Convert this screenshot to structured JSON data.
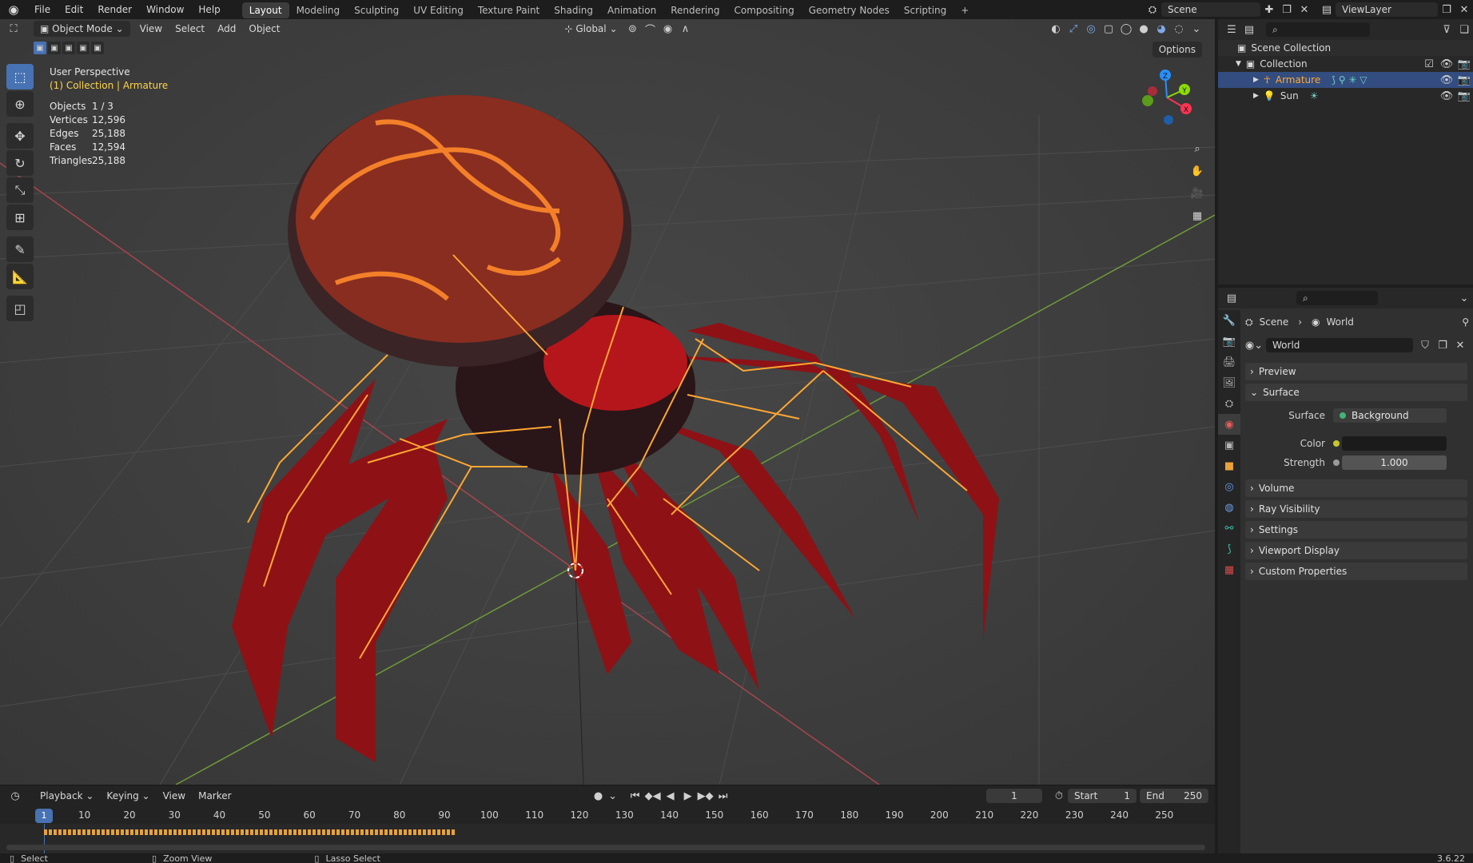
{
  "topbar": {
    "menu": [
      "File",
      "Edit",
      "Render",
      "Window",
      "Help"
    ],
    "workspaces": [
      "Layout",
      "Modeling",
      "Sculpting",
      "UV Editing",
      "Texture Paint",
      "Shading",
      "Animation",
      "Rendering",
      "Compositing",
      "Geometry Nodes",
      "Scripting"
    ],
    "active_workspace": "Layout",
    "add_tab": "+",
    "scene": "Scene",
    "view_layer": "ViewLayer"
  },
  "viewport": {
    "mode": "Object Mode",
    "menus": [
      "View",
      "Select",
      "Add",
      "Object"
    ],
    "orientation": "Global",
    "options": "Options",
    "overlay": {
      "title": "User Perspective",
      "collection": "(1) Collection | Armature",
      "stats": [
        {
          "label": "Objects",
          "value": "1 / 3"
        },
        {
          "label": "Vertices",
          "value": "12,596"
        },
        {
          "label": "Edges",
          "value": "25,188"
        },
        {
          "label": "Faces",
          "value": "12,594"
        },
        {
          "label": "Triangles",
          "value": "25,188"
        }
      ]
    },
    "gizmo": {
      "x": "X",
      "y": "Y",
      "z": "Z"
    },
    "colors": {
      "x_axis": "#ff3352",
      "y_axis": "#8bdc00",
      "z_axis": "#2890ff",
      "bones": "#ffa733",
      "body": "#b5161c",
      "glow": "#ff6a1a",
      "selection": "#4772b3"
    }
  },
  "timeline": {
    "menus": [
      "Playback",
      "Keying",
      "View",
      "Marker"
    ],
    "current_frame": "1",
    "start_label": "Start",
    "start": "1",
    "end_label": "End",
    "end": "250",
    "ruler_current": "1",
    "ticks": [
      "10",
      "20",
      "30",
      "40",
      "50",
      "60",
      "70",
      "80",
      "90",
      "100",
      "110",
      "120",
      "130",
      "140",
      "150",
      "160",
      "170",
      "180",
      "190",
      "200",
      "210",
      "220",
      "230",
      "240",
      "250"
    ]
  },
  "statusbar": {
    "select": "Select",
    "zoom": "Zoom View",
    "lasso": "Lasso Select",
    "version": "3.6.22"
  },
  "outliner": {
    "scene_collection": "Scene Collection",
    "collection": "Collection",
    "items": [
      "Armature",
      "Sun"
    ]
  },
  "properties": {
    "breadcrumb_scene": "Scene",
    "breadcrumb_world": "World",
    "datablock": "World",
    "panels": {
      "preview": "Preview",
      "surface": "Surface",
      "volume": "Volume",
      "ray_visibility": "Ray Visibility",
      "settings": "Settings",
      "viewport_display": "Viewport Display",
      "custom_properties": "Custom Properties"
    },
    "surface_label": "Surface",
    "surface_value": "Background",
    "color_label": "Color",
    "strength_label": "Strength",
    "strength_value": "1.000"
  }
}
